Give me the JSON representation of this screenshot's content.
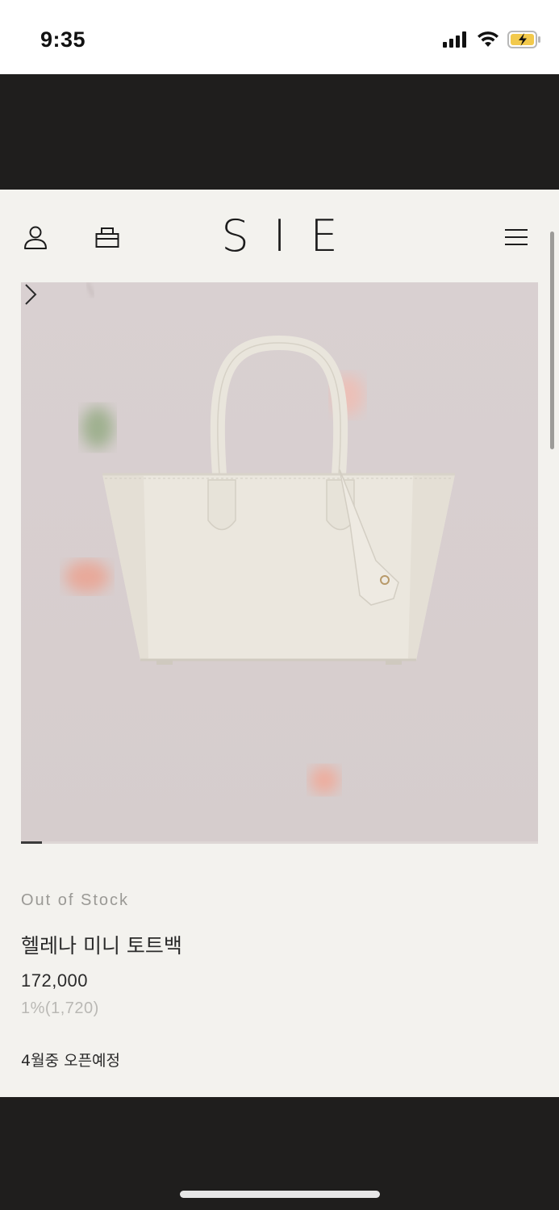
{
  "status_bar": {
    "time": "9:35"
  },
  "brand": {
    "logo": "SIE"
  },
  "product": {
    "stock_status": "Out of Stock",
    "name": "헬레나 미니 토트백",
    "price": "172,000",
    "points": "1%(1,720)",
    "notice": "4월중 오픈예정"
  },
  "gallery": {
    "current_slide": 1
  },
  "colors": {
    "page_bg": "#f3f2ee",
    "dark_band": "#1f1e1d",
    "hero_bg": "#d8cfd0",
    "bag": "#ebe7de"
  }
}
